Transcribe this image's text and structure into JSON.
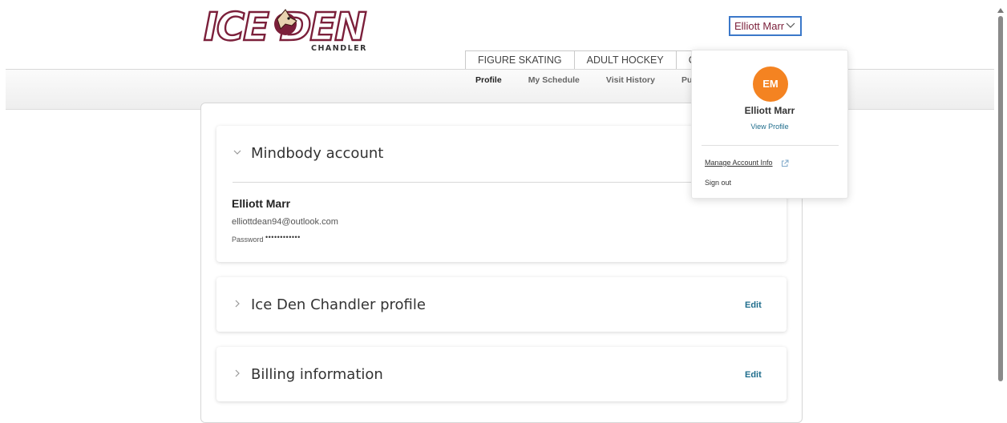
{
  "header": {
    "logo": {
      "text": "ICE DEN",
      "subtext": "CHANDLER"
    },
    "user_button_label": "Elliott Marr",
    "nav_tabs": [
      "FIGURE SKATING",
      "ADULT HOCKEY",
      "CL"
    ],
    "subnav": [
      "Profile",
      "My Schedule",
      "Visit History",
      "Purch"
    ]
  },
  "cards": {
    "mindbody": {
      "title": "Mindbody account",
      "name": "Elliott Marr",
      "email": "elliottdean94@outlook.com",
      "password_label": "Password",
      "password_value": "••••••••••••"
    },
    "profile": {
      "title": "Ice Den Chandler profile",
      "edit_label": "Edit"
    },
    "billing": {
      "title": "Billing information",
      "edit_label": "Edit"
    }
  },
  "user_menu": {
    "initials": "EM",
    "name": "Elliott Marr",
    "view_profile": "View Profile",
    "manage_account": "Manage Account Info",
    "sign_out": "Sign out"
  },
  "colors": {
    "brand_maroon": "#7b1f3a",
    "avatar_orange": "#f48321",
    "link_teal": "#1f6d8c"
  }
}
